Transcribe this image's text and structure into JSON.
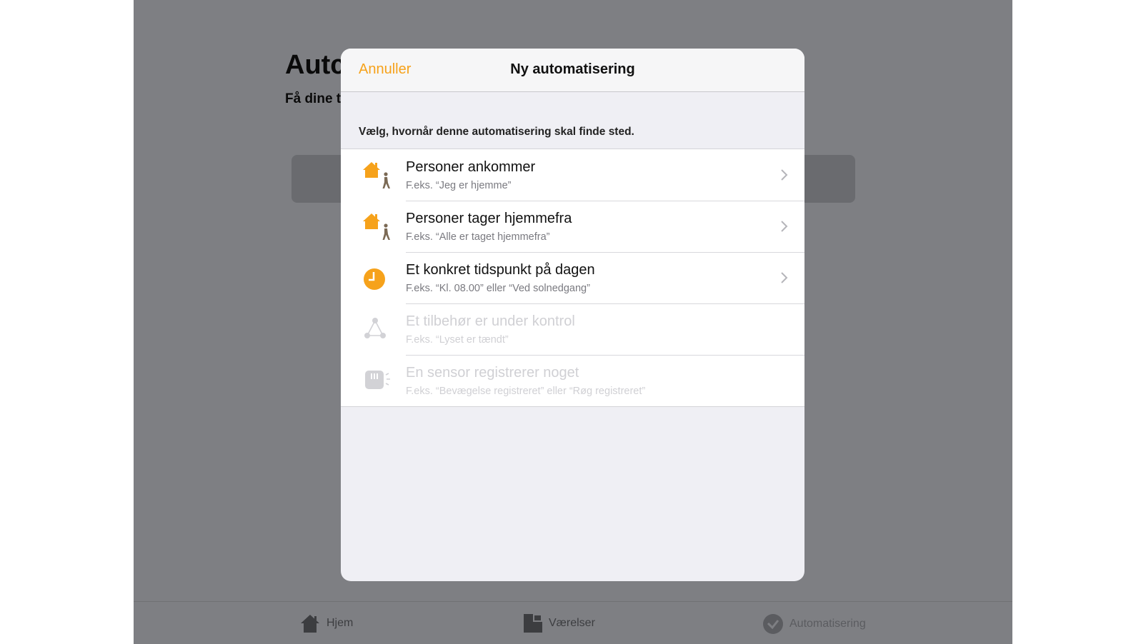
{
  "background": {
    "title": "Autc",
    "subtitle": "Få dine t"
  },
  "tabbar": {
    "tabs": [
      {
        "label": "Hjem",
        "icon": "home-icon"
      },
      {
        "label": "Værelser",
        "icon": "rooms-icon"
      },
      {
        "label": "Automatisering",
        "icon": "automation-icon",
        "selected": true
      }
    ]
  },
  "modal": {
    "cancel_label": "Annuller",
    "title": "Ny automatisering",
    "section_header": "Vælg, hvornår denne automatisering skal finde sted.",
    "options": [
      {
        "title": "Personer ankommer",
        "subtitle": "F.eks. “Jeg er hjemme”",
        "icon": "person-arrive-icon",
        "enabled": true
      },
      {
        "title": "Personer tager hjemmefra",
        "subtitle": "F.eks. “Alle er taget hjemmefra”",
        "icon": "person-leave-icon",
        "enabled": true
      },
      {
        "title": "Et konkret tidspunkt på dagen",
        "subtitle": "F.eks. “Kl. 08.00” eller “Ved solnedgang”",
        "icon": "clock-icon",
        "enabled": true
      },
      {
        "title": "Et tilbehør er under kontrol",
        "subtitle": "F.eks. “Lyset er tændt”",
        "icon": "accessory-icon",
        "enabled": false
      },
      {
        "title": "En sensor registrerer noget",
        "subtitle": "F.eks. “Bevægelse registreret” eller “Røg registreret”",
        "icon": "sensor-icon",
        "enabled": false
      }
    ]
  },
  "colors": {
    "accent": "#f6a21b",
    "dim_background": "#7e7f83"
  }
}
